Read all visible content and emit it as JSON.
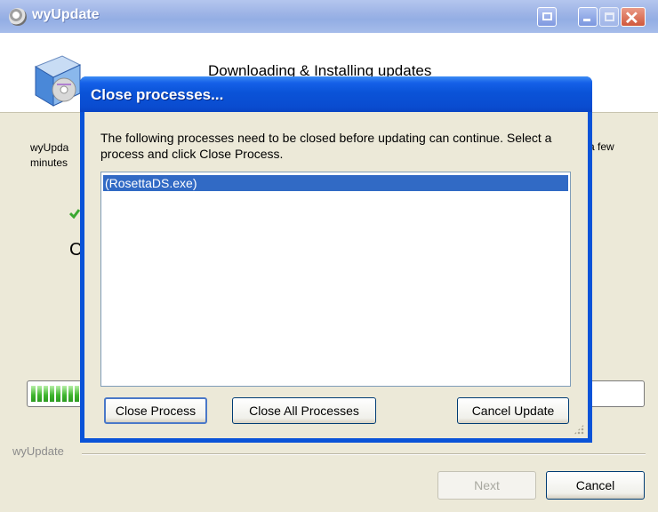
{
  "main_window": {
    "title": "wyUpdate",
    "header_title": "Downloading & Installing updates",
    "description_left": "wyUpda\nminutes",
    "description_right": "a few",
    "step_label": "C",
    "progress_fraction": 0.09,
    "footer_label": "wyUpdate",
    "next_button": "Next",
    "cancel_button": "Cancel"
  },
  "dialog": {
    "title": "Close processes...",
    "message": "The following processes need to be closed before updating can continue. Select a process and click Close Process.",
    "processes": [
      "(RosettaDS.exe)"
    ],
    "selected_process_index": 0,
    "buttons": {
      "close_process": "Close Process",
      "close_all": "Close All Processes",
      "cancel_update": "Cancel Update"
    }
  },
  "colors": {
    "dialog_title_blue": "#0a53d8",
    "selection_blue": "#316ac5",
    "progress_green": "#3cb42c",
    "main_title_inactive": "#9eb4e6"
  },
  "icons": {
    "title_icon": "wyupdate-logo-icon",
    "header_logo": "install-package-icon",
    "step_status": "checkmark-icon",
    "help": "help-window-icon",
    "minimize": "minimize-icon",
    "maximize": "maximize-icon",
    "close": "close-icon"
  }
}
